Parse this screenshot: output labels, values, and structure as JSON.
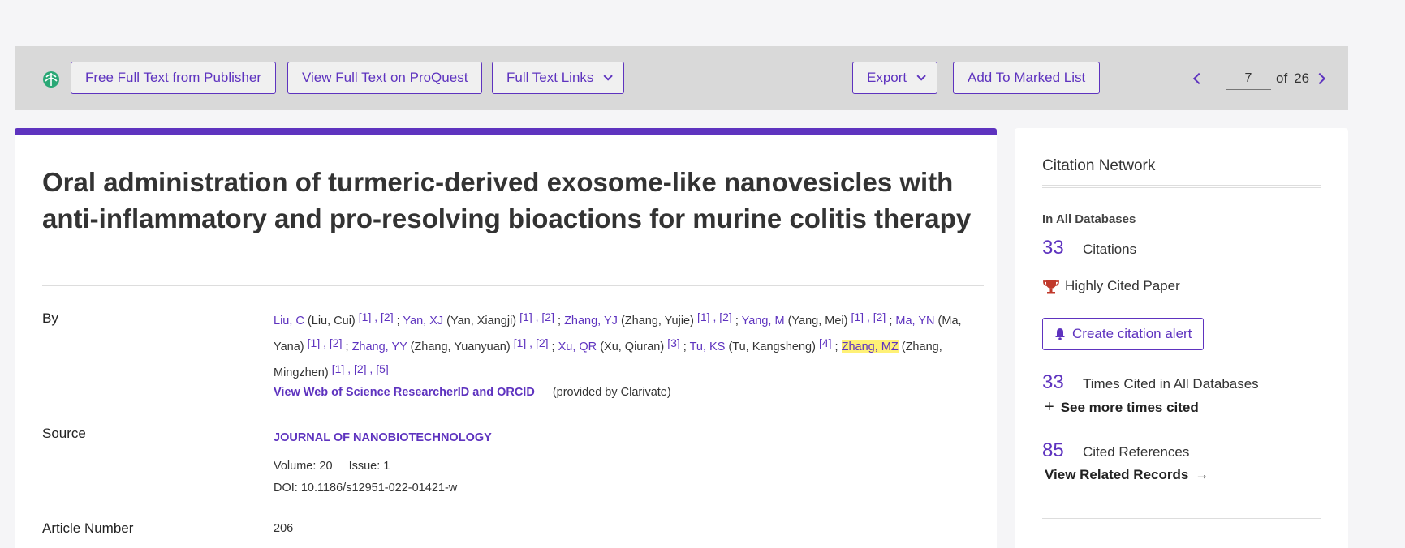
{
  "toolbar": {
    "free_full_text": "Free Full Text from Publisher",
    "proquest": "View Full Text on ProQuest",
    "full_text_links": "Full Text Links",
    "export": "Export",
    "add_marked": "Add To Marked List",
    "page_current": "7",
    "page_of": "of",
    "page_total": "26"
  },
  "record": {
    "title": "Oral administration of turmeric-derived exosome-like nanovesicles with anti-inflammatory and pro-resolving bioactions for murine colitis therapy",
    "by_label": "By",
    "authors": [
      {
        "abbr": "Liu, C",
        "full": "(Liu, Cui)",
        "aff": "[1] , [2]"
      },
      {
        "abbr": "Yan, XJ",
        "full": "(Yan, Xiangji)",
        "aff": "[1] , [2]"
      },
      {
        "abbr": "Zhang, YJ",
        "full": "(Zhang, Yujie)",
        "aff": "[1] , [2]"
      },
      {
        "abbr": "Yang, M",
        "full": "(Yang, Mei)",
        "aff": "[1] , [2]"
      },
      {
        "abbr": "Ma, YN",
        "full": "(Ma, Yana)",
        "aff": "[1] , [2]"
      },
      {
        "abbr": "Zhang, YY",
        "full": "(Zhang, Yuanyuan)",
        "aff": "[1] , [2]"
      },
      {
        "abbr": "Xu, QR",
        "full": "(Xu, Qiuran)",
        "aff": "[3]"
      },
      {
        "abbr": "Tu, KS",
        "full": "(Tu, Kangsheng)",
        "aff": "[4]"
      },
      {
        "abbr": "Zhang, MZ",
        "full": "(Zhang, Mingzhen)",
        "aff": "[1] , [2] , [5]"
      }
    ],
    "researcher_link": "View Web of Science ResearcherID and ORCID",
    "provided_by": "(provided by Clarivate)",
    "source_label": "Source",
    "journal": "JOURNAL OF NANOBIOTECHNOLOGY",
    "volume": "Volume: 20",
    "issue": "Issue: 1",
    "doi": "DOI: 10.1186/s12951-022-01421-w",
    "article_number_label": "Article Number",
    "article_number": "206"
  },
  "citation": {
    "heading": "Citation Network",
    "in_all": "In All Databases",
    "citations_count": "33",
    "citations_label": "Citations",
    "highly_cited": "Highly Cited Paper",
    "alert_button": "Create citation alert",
    "times_cited_count": "33",
    "times_cited_label": "Times Cited in All Databases",
    "see_more": "See more times cited",
    "cited_refs_count": "85",
    "cited_refs_label": "Cited References",
    "view_related": "View Related Records"
  },
  "colors": {
    "accent": "#5e33bf",
    "toolbar_bg": "#d9d9d9",
    "highlight": "#fff176",
    "trophy": "#c0392b"
  }
}
